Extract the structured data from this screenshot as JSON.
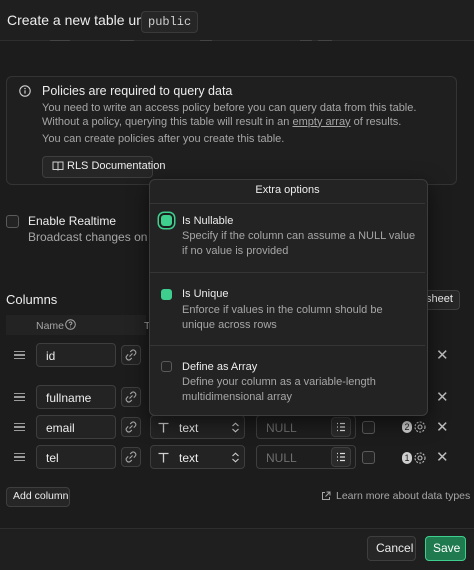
{
  "header": {
    "title": "Create a new table under",
    "schema": "public"
  },
  "alert": {
    "icon": "info-icon",
    "title": "Policies are required to query data",
    "text_before": "You need to write an access policy before you can query data from this table. Without a policy, querying this table will result in an ",
    "text_link": "empty array",
    "text_after": " of results.",
    "text2": "You can create policies after you create this table.",
    "doc_button": "RLS Documentation"
  },
  "realtime": {
    "label": "Enable Realtime",
    "description": "Broadcast changes on this"
  },
  "columns": {
    "title": "Columns",
    "sheet_button": "sheet",
    "header_name": "Name",
    "header_type": "T",
    "rows": [
      {
        "name": "id",
        "type": "",
        "default_placeholder": "",
        "badge": ""
      },
      {
        "name": "fullname",
        "type": "",
        "default_placeholder": "",
        "badge": ""
      },
      {
        "name": "email",
        "type": "text",
        "default_placeholder": "NULL",
        "badge": "2"
      },
      {
        "name": "tel",
        "type": "text",
        "default_placeholder": "NULL",
        "badge": "1"
      }
    ],
    "add_button": "Add column",
    "learn_more": "Learn more about data types"
  },
  "extra_options": {
    "title": "Extra options",
    "options": [
      {
        "title": "Is Nullable",
        "description": "Specify if the column can assume a NULL value if no value is provided",
        "checked": true
      },
      {
        "title": "Is Unique",
        "description": "Enforce if values in the column should be unique across rows",
        "checked": true
      },
      {
        "title": "Define as Array",
        "description": "Define your column as a variable-length multidimensional array",
        "checked": false
      }
    ]
  },
  "footer": {
    "cancel": "Cancel",
    "save": "Save"
  },
  "colors": {
    "accent": "#3ecf8e",
    "background": "#1c1c1c",
    "save_bg": "#1f7a4f"
  }
}
